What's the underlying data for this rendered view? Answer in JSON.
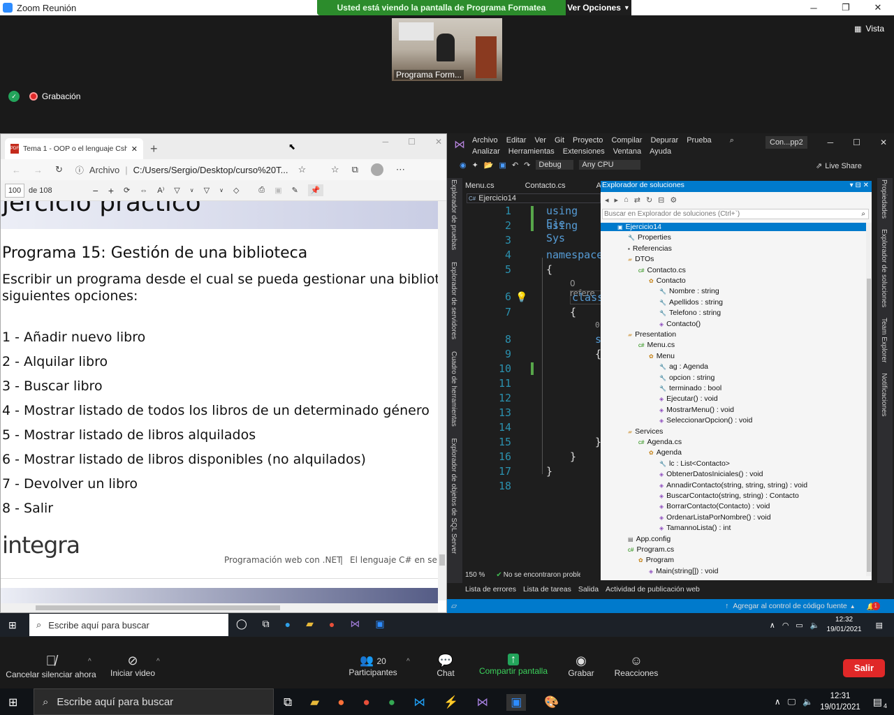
{
  "zoom": {
    "title": "Zoom Reunión",
    "banner_text": "Usted está viendo la pantalla de Programa Formatea",
    "view_options": "Ver Opciones",
    "view_label": "Vista",
    "video_name": "Programa Form...",
    "recording_label": "Grabación",
    "controls": {
      "mute": "Cancelar silenciar ahora",
      "video": "Iniciar video",
      "participants": "Participantes",
      "participants_count": "20",
      "chat": "Chat",
      "share": "Compartir pantalla",
      "record": "Grabar",
      "reactions": "Reacciones",
      "leave": "Salir"
    }
  },
  "edge": {
    "tab_title": "Tema 1 - OOP o el lenguaje Csh...",
    "address_prefix": "Archivo",
    "address": "C:/Users/Sergio/Desktop/curso%20T...",
    "page_num": "100",
    "page_total": "de 108",
    "pdf": {
      "header_partial": "jercicio práctico",
      "title": "Programa 15: Gestión de una biblioteca",
      "desc1": "Escribir un programa desde el cual se pueda gestionar una biblioteca.",
      "desc2": "siguientes opciones:",
      "options": [
        "1 - Añadir nuevo libro",
        "2 - Alquilar libro",
        "3 - Buscar libro",
        "4 - Mostrar listado de todos los libros de un determinado género",
        "5 - Mostrar listado de libros alquilados",
        "6 - Mostrar listado de libros disponibles (no alquilados)",
        "7 - Devolver un libro",
        "8 - Salir"
      ],
      "logo": "integra",
      "footer_left": "Programación web con .NET",
      "footer_sep": "|",
      "footer_right": "El lenguaje C# en serio"
    }
  },
  "vs": {
    "menus_row1": [
      "Archivo",
      "Editar",
      "Ver",
      "Git",
      "Proyecto",
      "Compilar",
      "Depurar",
      "Prueba"
    ],
    "menus_row2": [
      "Analizar",
      "Herramientas",
      "Extensiones",
      "Ventana",
      "Ayuda"
    ],
    "solution_short": "Con...pp2",
    "config": "Debug",
    "platform": "Any CPU",
    "live_share": "Live Share",
    "left_vtabs": [
      "Explorador de pruebas",
      "Explorador de servidores",
      "Cuadro de herramientas",
      "Explorador de objetos de SQL Server"
    ],
    "right_vtabs": [
      "Propiedades",
      "Explorador de soluciones",
      "Team Explorer",
      "Notificaciones"
    ],
    "doc_tabs": [
      "Menu.cs",
      "Contacto.cs",
      "Age"
    ],
    "nav_project": "Ejercicio14",
    "code_lines": [
      {
        "n": "1",
        "t": "using Eje"
      },
      {
        "n": "2",
        "t": "using Sys"
      },
      {
        "n": "3",
        "t": ""
      },
      {
        "n": "4",
        "t": "namespace"
      },
      {
        "n": "5",
        "t": "{"
      },
      {
        "n": "",
        "t": "0 refere"
      },
      {
        "n": "6",
        "t": "class"
      },
      {
        "n": "7",
        "t": "{"
      },
      {
        "n": "",
        "t": "0"
      },
      {
        "n": "8",
        "t": "s"
      },
      {
        "n": "9",
        "t": "{"
      },
      {
        "n": "10",
        "t": ""
      },
      {
        "n": "11",
        "t": ""
      },
      {
        "n": "12",
        "t": ""
      },
      {
        "n": "13",
        "t": ""
      },
      {
        "n": "14",
        "t": ""
      },
      {
        "n": "15",
        "t": "}"
      },
      {
        "n": "16",
        "t": "}"
      },
      {
        "n": "17",
        "t": "}"
      },
      {
        "n": "18",
        "t": ""
      }
    ],
    "zoom_level": "150 %",
    "status_issues": "No se encontraron probler",
    "solution_explorer": {
      "title": "Explorador de soluciones",
      "search_placeholder": "Buscar en Explorador de soluciones (Ctrl+`)",
      "items": [
        {
          "label": "Ejercicio14",
          "depth": 0,
          "icon": "project-icon",
          "selected": true
        },
        {
          "label": "Properties",
          "depth": 1,
          "icon": "wrench-icon"
        },
        {
          "label": "Referencias",
          "depth": 1,
          "icon": "references-icon"
        },
        {
          "label": "DTOs",
          "depth": 1,
          "icon": "folder-icon"
        },
        {
          "label": "Contacto.cs",
          "depth": 2,
          "icon": "csharp-file-icon"
        },
        {
          "label": "Contacto",
          "depth": 3,
          "icon": "class-icon"
        },
        {
          "label": "Nombre : string",
          "depth": 4,
          "icon": "property-icon"
        },
        {
          "label": "Apellidos : string",
          "depth": 4,
          "icon": "property-icon"
        },
        {
          "label": "Telefono : string",
          "depth": 4,
          "icon": "property-icon"
        },
        {
          "label": "Contacto()",
          "depth": 4,
          "icon": "method-icon"
        },
        {
          "label": "Presentation",
          "depth": 1,
          "icon": "folder-icon"
        },
        {
          "label": "Menu.cs",
          "depth": 2,
          "icon": "csharp-file-icon"
        },
        {
          "label": "Menu",
          "depth": 3,
          "icon": "class-icon"
        },
        {
          "label": "ag : Agenda",
          "depth": 4,
          "icon": "property-icon"
        },
        {
          "label": "opcion : string",
          "depth": 4,
          "icon": "property-icon"
        },
        {
          "label": "terminado : bool",
          "depth": 4,
          "icon": "property-icon"
        },
        {
          "label": "Ejecutar() : void",
          "depth": 4,
          "icon": "method-icon"
        },
        {
          "label": "MostrarMenu() : void",
          "depth": 4,
          "icon": "method-icon"
        },
        {
          "label": "SeleccionarOpcion() : void",
          "depth": 4,
          "icon": "method-icon"
        },
        {
          "label": "Services",
          "depth": 1,
          "icon": "folder-icon"
        },
        {
          "label": "Agenda.cs",
          "depth": 2,
          "icon": "csharp-file-icon"
        },
        {
          "label": "Agenda",
          "depth": 3,
          "icon": "class-icon"
        },
        {
          "label": "lc : List<Contacto>",
          "depth": 4,
          "icon": "property-icon"
        },
        {
          "label": "ObtenerDatosIniciales() : void",
          "depth": 4,
          "icon": "method-icon"
        },
        {
          "label": "AnnadirContacto(string, string, string) : void",
          "depth": 4,
          "icon": "method-icon"
        },
        {
          "label": "BuscarContacto(string, string) : Contacto",
          "depth": 4,
          "icon": "method-icon"
        },
        {
          "label": "BorrarContacto(Contacto) : void",
          "depth": 4,
          "icon": "method-icon"
        },
        {
          "label": "OrdenarListaPorNombre() : void",
          "depth": 4,
          "icon": "method-icon"
        },
        {
          "label": "TamannoLista() : int",
          "depth": 4,
          "icon": "method-icon"
        },
        {
          "label": "App.config",
          "depth": 1,
          "icon": "config-icon"
        },
        {
          "label": "Program.cs",
          "depth": 1,
          "icon": "csharp-file-icon"
        },
        {
          "label": "Program",
          "depth": 2,
          "icon": "class-icon"
        },
        {
          "label": "Main(string[]) : void",
          "depth": 3,
          "icon": "method-icon"
        }
      ]
    },
    "bottom_tabs": [
      "Lista de errores",
      "Lista de tareas",
      "Salida",
      "Actividad de publicación web"
    ],
    "status_source": "Agregar al control de código fuente",
    "status_badge": "1"
  },
  "inner_taskbar": {
    "search": "Escribe aquí para buscar",
    "time": "12:32",
    "date": "19/01/2021"
  },
  "outer_taskbar": {
    "search": "Escribe aquí para buscar",
    "time": "12:31",
    "date": "19/01/2021",
    "notif_count": "4"
  },
  "colors": {
    "zoom_green": "#2c8c2c",
    "vs_blue": "#007acc",
    "vs_purple": "#68217a",
    "leave_red": "#e02828"
  }
}
